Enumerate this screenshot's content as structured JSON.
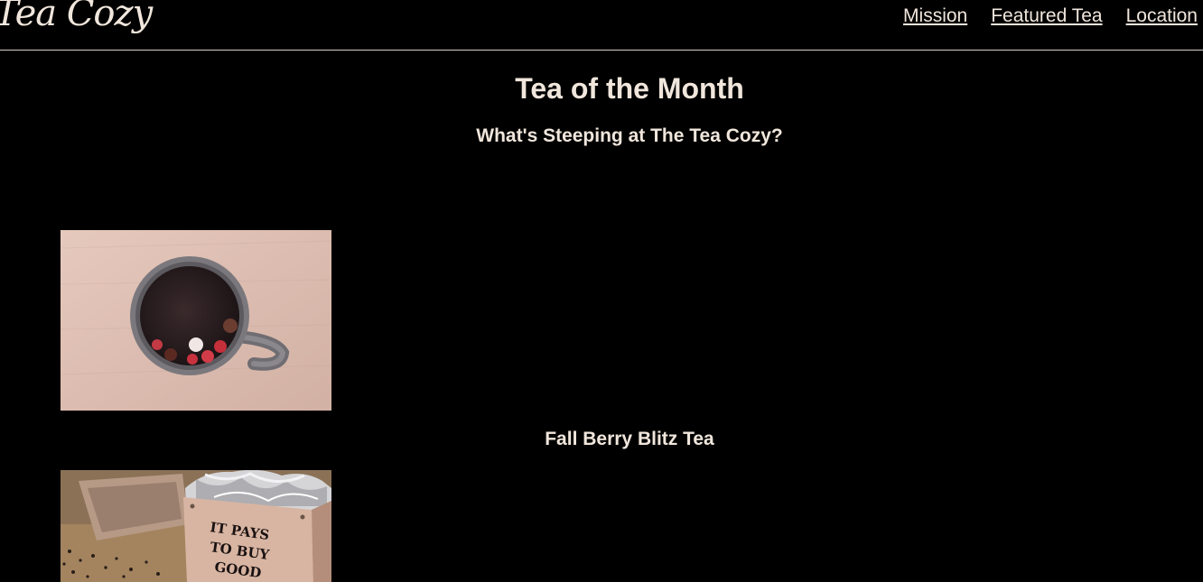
{
  "header": {
    "logo_text": "Tea Cozy",
    "nav": [
      {
        "label": "Mission"
      },
      {
        "label": "Featured Tea"
      },
      {
        "label": "Location"
      }
    ]
  },
  "main": {
    "title": "Tea of the Month",
    "subtitle": "What's Steeping at The Tea Cozy?",
    "teas": [
      {
        "name": "Fall Berry Blitz Tea",
        "image": "berry-tea-mug-photo"
      },
      {
        "name": "",
        "image": "tea-box-photo",
        "box_text": [
          "IT PAYS",
          "TO BUY",
          "GOOD"
        ]
      }
    ]
  },
  "colors": {
    "background": "#000000",
    "text": "#f0e6dc",
    "divider": "#d9cfc6"
  }
}
